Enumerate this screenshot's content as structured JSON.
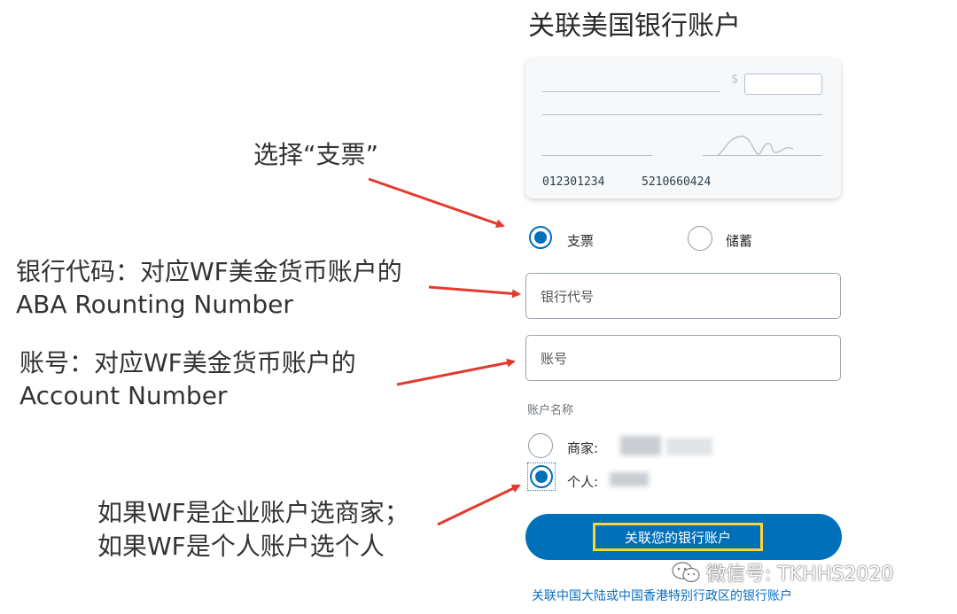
{
  "page": {
    "title": "关联美国银行账户"
  },
  "check_preview": {
    "currency_symbol": "$",
    "routing_number": "012301234",
    "account_number": "5210660424"
  },
  "account_type": {
    "options": [
      {
        "label": "支票",
        "selected": true
      },
      {
        "label": "储蓄",
        "selected": false
      }
    ]
  },
  "fields": {
    "routing_placeholder": "银行代号",
    "account_placeholder": "账号"
  },
  "account_name": {
    "section_label": "账户名称",
    "options": [
      {
        "label": "商家:",
        "selected": false
      },
      {
        "label": "个人:",
        "selected": true
      }
    ]
  },
  "actions": {
    "link_button_label": "关联您的银行账户",
    "other_region_link": "关联中国大陆或中国香港特别行政区的银行账户"
  },
  "annotations": {
    "select_check": "选择“支票”",
    "routing_note_line1": "银行代码：对应WF美金货币账户的",
    "routing_note_line2": "ABA Rounting Number",
    "account_note_line1": "账号：对应WF美金货币账户的",
    "account_note_line2": "Account Number",
    "name_note_line1": "如果WF是企业账户选商家；",
    "name_note_line2": "如果WF是个人账户选个人"
  },
  "watermark": {
    "text": "微信号: TKHHS2020"
  },
  "colors": {
    "brand_blue": "#0070ba",
    "highlight_yellow": "#ffd23a",
    "arrow_red": "#e23a2e",
    "link_blue": "#0b6fc1"
  }
}
